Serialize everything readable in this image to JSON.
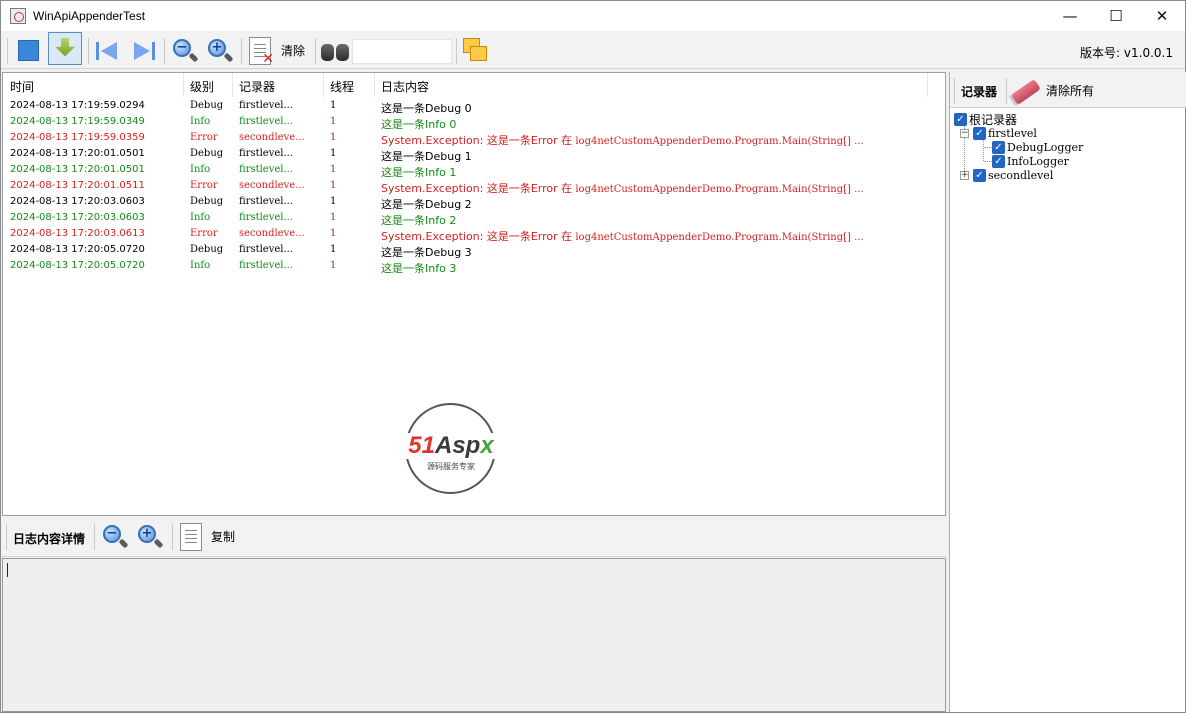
{
  "window": {
    "title": "WinApiAppenderTest",
    "minimize": "—",
    "maximize": "☐",
    "close": "✕"
  },
  "toolbar": {
    "clear_label": "清除",
    "search_value": "",
    "version": "版本号: v1.0.0.1"
  },
  "log_table": {
    "headers": {
      "time": "时间",
      "level": "级别",
      "logger": "记录器",
      "thread": "线程",
      "message": "日志内容"
    },
    "rows": [
      {
        "time": "2024-08-13 17:19:59.0294",
        "level": "Debug",
        "logger": "firstlevel...",
        "thread": "1",
        "msg_a": "这是一条",
        "msg_b": "Debug 0",
        "msg_c": ""
      },
      {
        "time": "2024-08-13 17:19:59.0349",
        "level": "Info",
        "logger": "firstlevel...",
        "thread": "1",
        "msg_a": "这是一条",
        "msg_b": "Info 0",
        "msg_c": ""
      },
      {
        "time": "2024-08-13 17:19:59.0359",
        "level": "Error",
        "logger": "secondleve...",
        "thread": "1",
        "msg_a": "System.Exception: ",
        "msg_b": "这是一条Error   在",
        "msg_c": " log4netCustomAppenderDemo.Program.Main(String[] ..."
      },
      {
        "time": "2024-08-13 17:20:01.0501",
        "level": "Debug",
        "logger": "firstlevel...",
        "thread": "1",
        "msg_a": "这是一条",
        "msg_b": "Debug 1",
        "msg_c": ""
      },
      {
        "time": "2024-08-13 17:20:01.0501",
        "level": "Info",
        "logger": "firstlevel...",
        "thread": "1",
        "msg_a": "这是一条",
        "msg_b": "Info 1",
        "msg_c": ""
      },
      {
        "time": "2024-08-13 17:20:01.0511",
        "level": "Error",
        "logger": "secondleve...",
        "thread": "1",
        "msg_a": "System.Exception: ",
        "msg_b": "这是一条Error   在",
        "msg_c": " log4netCustomAppenderDemo.Program.Main(String[] ..."
      },
      {
        "time": "2024-08-13 17:20:03.0603",
        "level": "Debug",
        "logger": "firstlevel...",
        "thread": "1",
        "msg_a": "这是一条",
        "msg_b": "Debug 2",
        "msg_c": ""
      },
      {
        "time": "2024-08-13 17:20:03.0603",
        "level": "Info",
        "logger": "firstlevel...",
        "thread": "1",
        "msg_a": "这是一条",
        "msg_b": "Info 2",
        "msg_c": ""
      },
      {
        "time": "2024-08-13 17:20:03.0613",
        "level": "Error",
        "logger": "secondleve...",
        "thread": "1",
        "msg_a": "System.Exception: ",
        "msg_b": "这是一条Error   在",
        "msg_c": " log4netCustomAppenderDemo.Program.Main(String[] ..."
      },
      {
        "time": "2024-08-13 17:20:05.0720",
        "level": "Debug",
        "logger": "firstlevel...",
        "thread": "1",
        "msg_a": "这是一条",
        "msg_b": "Debug 3",
        "msg_c": ""
      },
      {
        "time": "2024-08-13 17:20:05.0720",
        "level": "Info",
        "logger": "firstlevel...",
        "thread": "1",
        "msg_a": "这是一条",
        "msg_b": "Info 3",
        "msg_c": ""
      }
    ]
  },
  "watermark": {
    "n51": "51",
    "a": "A",
    "spx": "sp",
    "x": "x",
    "sub": "源码服务专家"
  },
  "detail": {
    "title": "日志内容详情",
    "copy_label": "复制"
  },
  "logger_panel": {
    "title": "记录器",
    "clear_all": "清除所有",
    "tree": {
      "root": "根记录器",
      "first": "firstlevel",
      "debug": "DebugLogger",
      "info": "InfoLogger",
      "second": "secondlevel"
    }
  },
  "colors": {
    "debug": "#000000",
    "info": "#138a13",
    "error": "#d21f1f"
  }
}
